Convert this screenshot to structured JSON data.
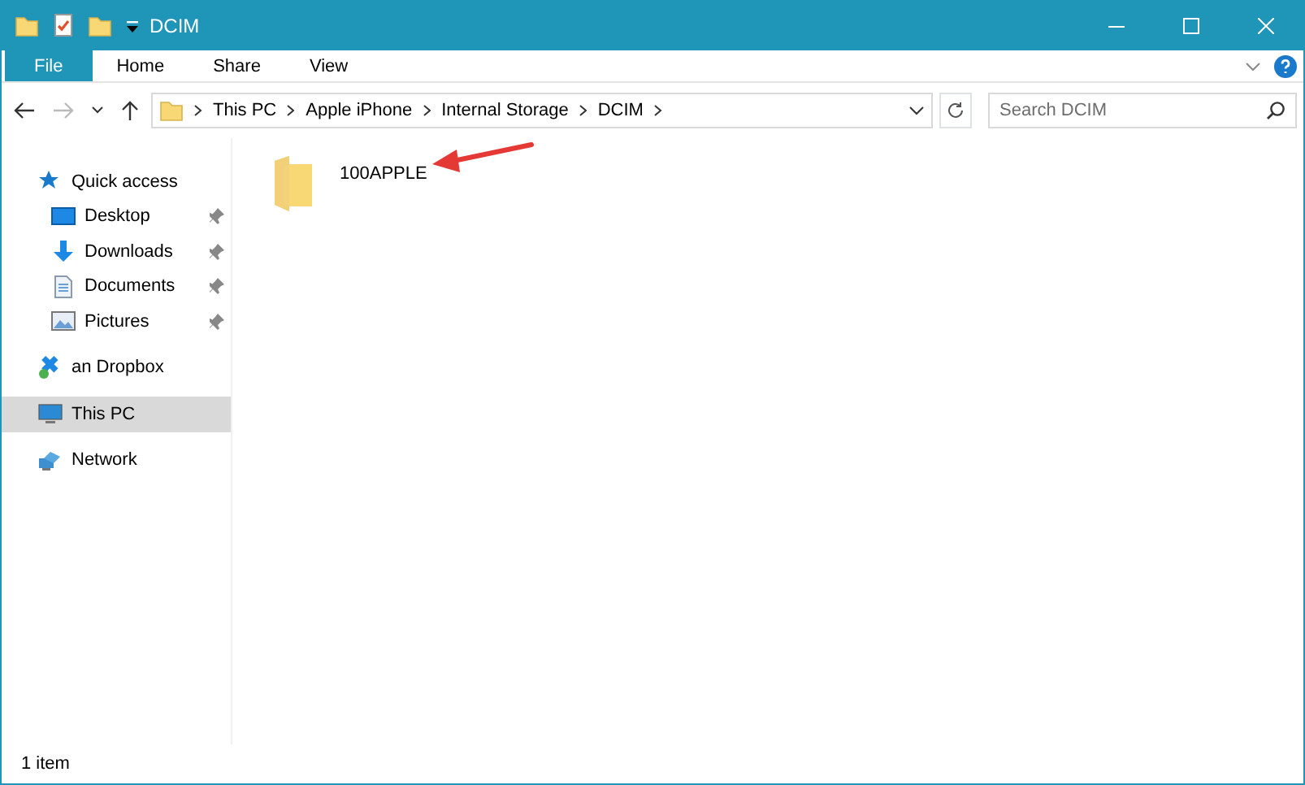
{
  "window": {
    "title": "DCIM"
  },
  "ribbon": {
    "tabs": [
      {
        "label": "File",
        "kind": "file",
        "selected": false
      },
      {
        "label": "Home",
        "kind": "tab",
        "selected": false
      },
      {
        "label": "Share",
        "kind": "tab",
        "selected": false
      },
      {
        "label": "View",
        "kind": "tab",
        "selected": false
      }
    ]
  },
  "address": {
    "breadcrumbs": [
      "This PC",
      "Apple iPhone",
      "Internal Storage",
      "DCIM"
    ],
    "search_placeholder": "Search DCIM"
  },
  "sidebar": {
    "items": [
      {
        "label": "Quick access",
        "selected": false,
        "children": [
          {
            "label": "Desktop",
            "pinned": true,
            "selected": false
          },
          {
            "label": "Downloads",
            "pinned": true,
            "selected": false
          },
          {
            "label": "Documents",
            "pinned": true,
            "selected": false
          },
          {
            "label": "Pictures",
            "pinned": true,
            "selected": false
          }
        ]
      },
      {
        "label": "an Dropbox",
        "selected": false
      },
      {
        "label": "This PC",
        "selected": true
      },
      {
        "label": "Network",
        "selected": false
      }
    ]
  },
  "files": [
    {
      "name": "100APPLE"
    }
  ],
  "status_bar": {
    "text": "1 item"
  }
}
